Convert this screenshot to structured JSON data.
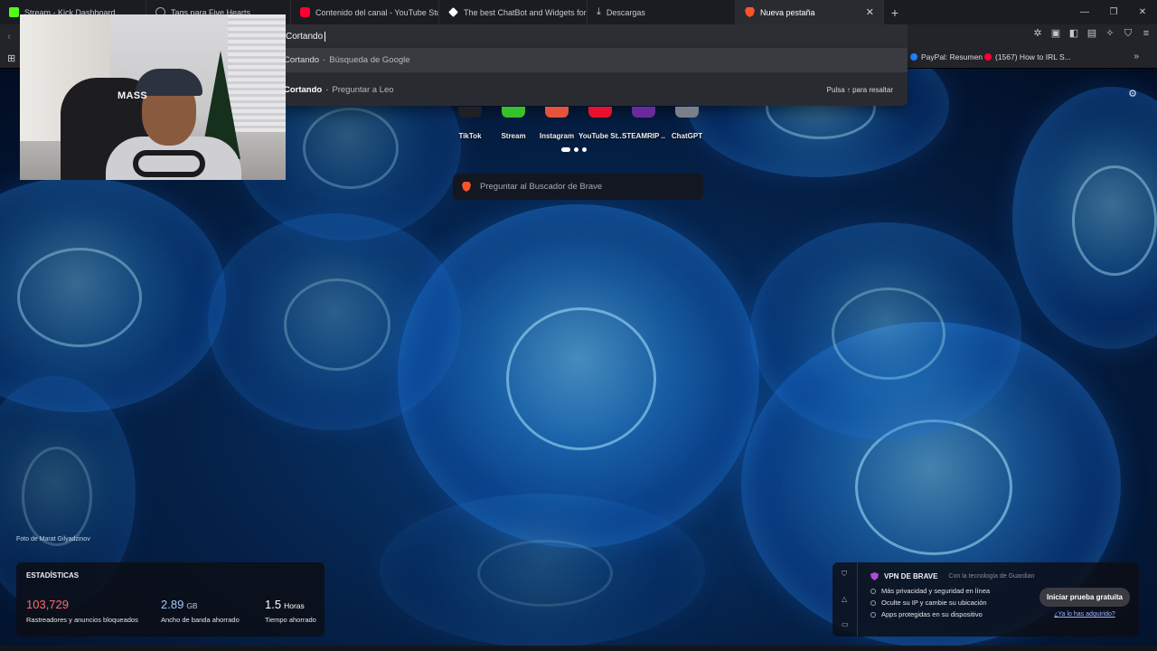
{
  "tabs": [
    {
      "label": "Stream - Kick Dashboard",
      "icon": "kick-icon",
      "color": "#53fc18"
    },
    {
      "label": "Tags para Five Hearts",
      "icon": "globe-icon",
      "color": "#9aa0aa"
    },
    {
      "label": "Contenido del canal - YouTube Studio",
      "icon": "youtube-icon",
      "color": "#ff0033"
    },
    {
      "label": "The best ChatBot and Widgets for Kick",
      "icon": "diamond-icon",
      "color": "#ffffff"
    },
    {
      "label": "Descargas",
      "icon": "download-icon",
      "color": "#c9cad1"
    },
    {
      "label": "Nueva pestaña",
      "icon": "brave-icon",
      "color": "#fb542b",
      "active": true
    }
  ],
  "omnibox": {
    "value": "Cortando"
  },
  "suggestions": [
    {
      "query": "Cortando",
      "source": "Búsqueda de Google"
    },
    {
      "query": "Cortando",
      "source": "Preguntar a Leo",
      "hint": "Pulsa ↑ para resaltar"
    }
  ],
  "bookmarks": [
    {
      "label": "PayPal: Resumen",
      "color": "#1e88ff"
    },
    {
      "label": "(1567) How to IRL S...",
      "color": "#ff0033"
    }
  ],
  "top_sites": [
    {
      "label": "TikTok",
      "color": "#202024"
    },
    {
      "label": "Stream",
      "color": "#37c02a"
    },
    {
      "label": "Instagram",
      "color": "#e5533c"
    },
    {
      "label": "YouTube St...",
      "color": "#e8102a"
    },
    {
      "label": "STEAMRIP ...",
      "color": "#6a2a9c"
    },
    {
      "label": "ChatGPT",
      "color": "#7a7f8a"
    }
  ],
  "search_pill": {
    "placeholder": "Preguntar al Buscador de Brave"
  },
  "webcam": {
    "overlay_text": "MASS"
  },
  "photo_credit": "Foto de Marat Gilyadzinov",
  "stats": {
    "title": "ESTADÍSTICAS",
    "blocked": {
      "value": "103,729",
      "label": "Rastreadores y anuncios bloqueados",
      "color": "#ff6b6b"
    },
    "bandwidth": {
      "value": "2.89",
      "unit": "GB",
      "label": "Ancho de banda ahorrado",
      "color": "#9ec8ff"
    },
    "time": {
      "value": "1.5",
      "unit": "Horas",
      "label": "Tiempo ahorrado",
      "color": "#ffffff"
    }
  },
  "vpn": {
    "title": "VPN DE BRAVE",
    "powered_by": "Con la tecnología de Guardian",
    "features": [
      "Más privacidad y seguridad en línea",
      "Oculte su IP y cambie su ubicación",
      "Apps protegidas en su dispositivo"
    ],
    "trial_button": "Iniciar prueba gratuita",
    "acquired_link": "¿Ya lo has adquirido?"
  }
}
